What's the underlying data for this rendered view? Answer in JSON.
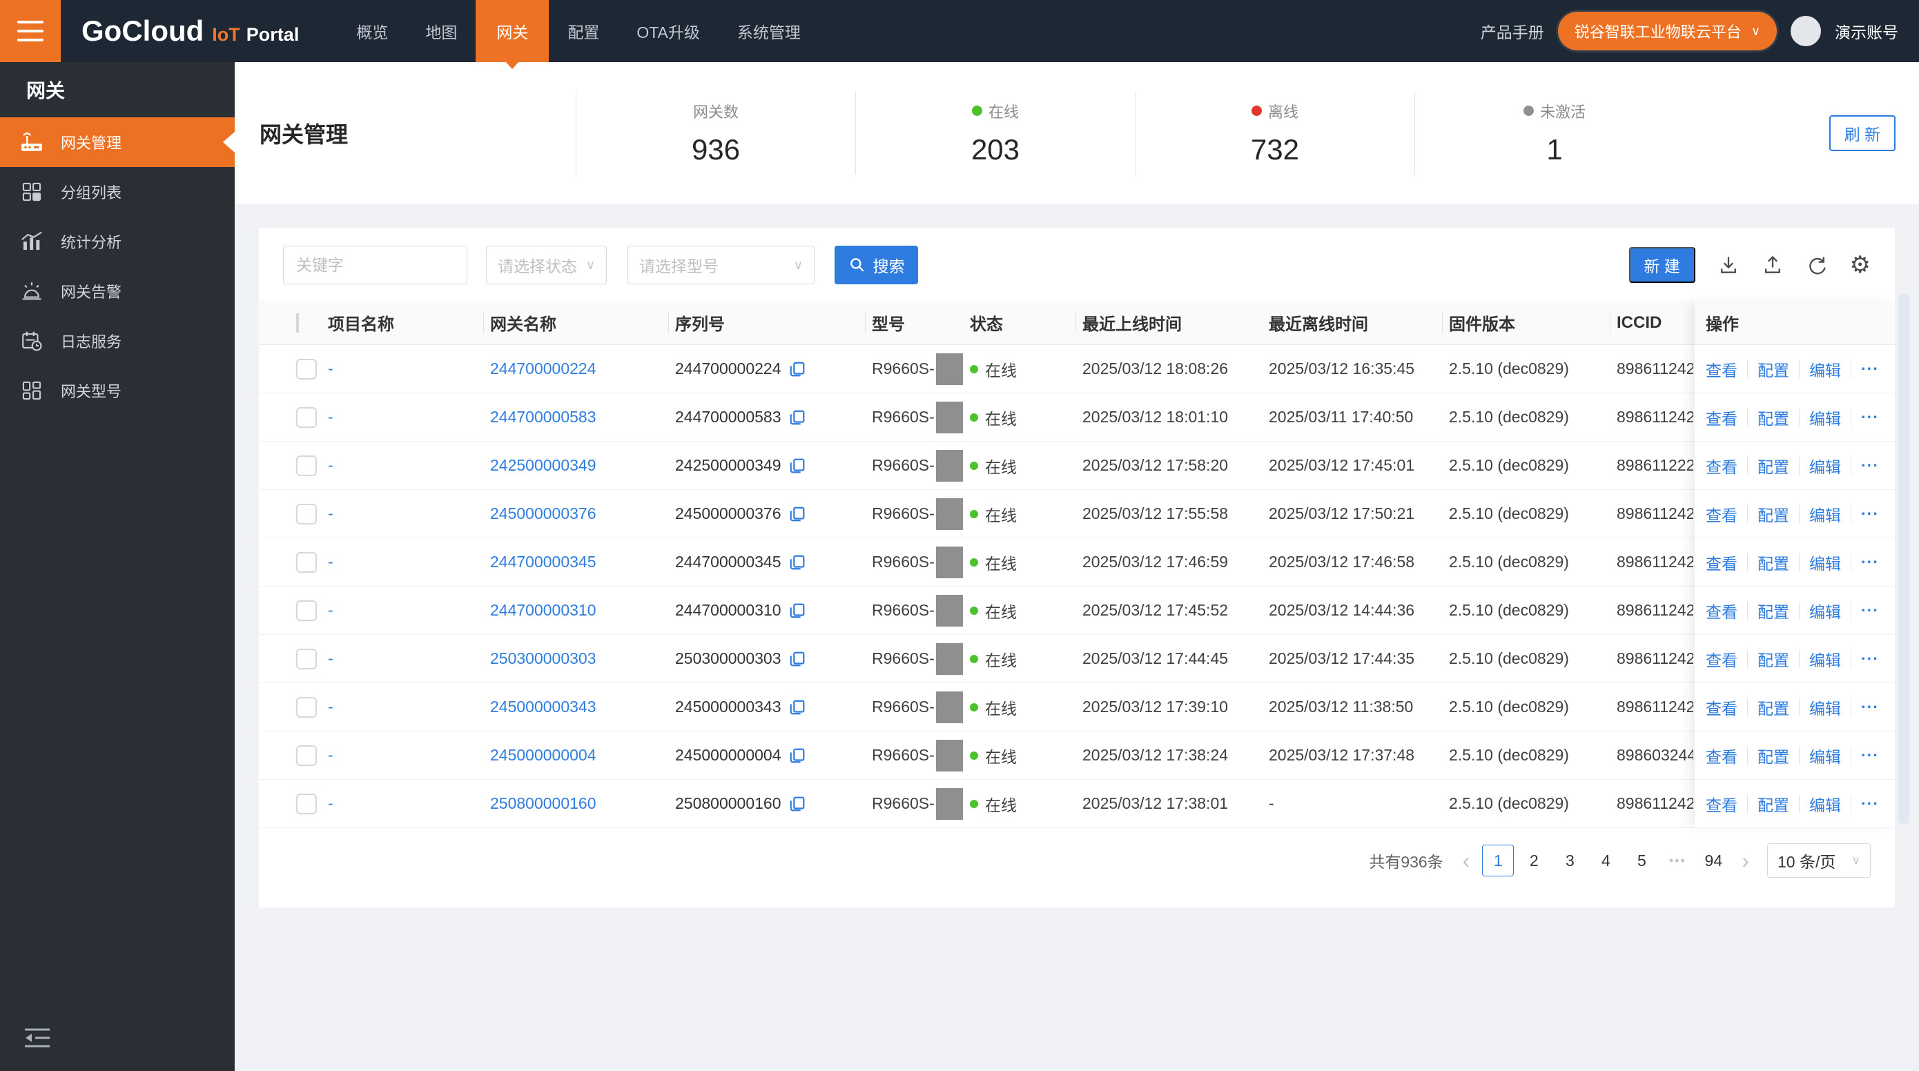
{
  "navbar": {
    "logo": {
      "brand": "GoCloud",
      "product": "IoT",
      "suffix": "Portal"
    },
    "items": [
      {
        "label": "概览"
      },
      {
        "label": "地图"
      },
      {
        "label": "网关",
        "active": true
      },
      {
        "label": "配置"
      },
      {
        "label": "OTA升级"
      },
      {
        "label": "系统管理"
      }
    ],
    "manual_link": "产品手册",
    "platform_selector": "锐谷智联工业物联云平台",
    "account": "演示账号"
  },
  "sidebar": {
    "title": "网关",
    "items": [
      {
        "label": "网关管理",
        "icon": "gateway-icon",
        "active": true
      },
      {
        "label": "分组列表",
        "icon": "group-list-icon"
      },
      {
        "label": "统计分析",
        "icon": "statistics-icon"
      },
      {
        "label": "网关告警",
        "icon": "alarm-icon"
      },
      {
        "label": "日志服务",
        "icon": "log-service-icon"
      },
      {
        "label": "网关型号",
        "icon": "gateway-model-icon"
      }
    ]
  },
  "header": {
    "title": "网关管理",
    "stats": [
      {
        "label": "网关数",
        "value": "936",
        "dot_color": ""
      },
      {
        "label": "在线",
        "value": "203",
        "dot_color": "#4cc22a"
      },
      {
        "label": "离线",
        "value": "732",
        "dot_color": "#e2352c"
      },
      {
        "label": "未激活",
        "value": "1",
        "dot_color": "#8f8f8f"
      }
    ],
    "refresh_label": "刷 新"
  },
  "toolbar": {
    "keyword_placeholder": "关键字",
    "status_placeholder": "请选择状态",
    "model_placeholder": "请选择型号",
    "search_label": "搜索",
    "create_label": "新 建"
  },
  "table": {
    "columns": [
      "项目名称",
      "网关名称",
      "序列号",
      "型号",
      "状态",
      "最近上线时间",
      "最近离线时间",
      "固件版本",
      "ICCID",
      "操作"
    ],
    "actions": [
      "查看",
      "配置",
      "编辑",
      "···"
    ],
    "rows": [
      {
        "project": "-",
        "name": "244700000224",
        "serial": "244700000224",
        "model": "R9660S-",
        "status": "在线",
        "online_time": "2025/03/12 18:08:26",
        "offline_time": "2025/03/12 16:35:45",
        "firmware": "2.5.10 (dec0829)",
        "iccid": "898611242"
      },
      {
        "project": "-",
        "name": "244700000583",
        "serial": "244700000583",
        "model": "R9660S-",
        "status": "在线",
        "online_time": "2025/03/12 18:01:10",
        "offline_time": "2025/03/11 17:40:50",
        "firmware": "2.5.10 (dec0829)",
        "iccid": "898611242"
      },
      {
        "project": "-",
        "name": "242500000349",
        "serial": "242500000349",
        "model": "R9660S-",
        "status": "在线",
        "online_time": "2025/03/12 17:58:20",
        "offline_time": "2025/03/12 17:45:01",
        "firmware": "2.5.10 (dec0829)",
        "iccid": "898611222"
      },
      {
        "project": "-",
        "name": "245000000376",
        "serial": "245000000376",
        "model": "R9660S-",
        "status": "在线",
        "online_time": "2025/03/12 17:55:58",
        "offline_time": "2025/03/12 17:50:21",
        "firmware": "2.5.10 (dec0829)",
        "iccid": "898611242"
      },
      {
        "project": "-",
        "name": "244700000345",
        "serial": "244700000345",
        "model": "R9660S-",
        "status": "在线",
        "online_time": "2025/03/12 17:46:59",
        "offline_time": "2025/03/12 17:46:58",
        "firmware": "2.5.10 (dec0829)",
        "iccid": "898611242"
      },
      {
        "project": "-",
        "name": "244700000310",
        "serial": "244700000310",
        "model": "R9660S-",
        "status": "在线",
        "online_time": "2025/03/12 17:45:52",
        "offline_time": "2025/03/12 14:44:36",
        "firmware": "2.5.10 (dec0829)",
        "iccid": "898611242"
      },
      {
        "project": "-",
        "name": "250300000303",
        "serial": "250300000303",
        "model": "R9660S-",
        "status": "在线",
        "online_time": "2025/03/12 17:44:45",
        "offline_time": "2025/03/12 17:44:35",
        "firmware": "2.5.10 (dec0829)",
        "iccid": "898611242"
      },
      {
        "project": "-",
        "name": "245000000343",
        "serial": "245000000343",
        "model": "R9660S-",
        "status": "在线",
        "online_time": "2025/03/12 17:39:10",
        "offline_time": "2025/03/12 11:38:50",
        "firmware": "2.5.10 (dec0829)",
        "iccid": "898611242"
      },
      {
        "project": "-",
        "name": "245000000004",
        "serial": "245000000004",
        "model": "R9660S-",
        "status": "在线",
        "online_time": "2025/03/12 17:38:24",
        "offline_time": "2025/03/12 17:37:48",
        "firmware": "2.5.10 (dec0829)",
        "iccid": "898603244"
      },
      {
        "project": "-",
        "name": "250800000160",
        "serial": "250800000160",
        "model": "R9660S-",
        "status": "在线",
        "online_time": "2025/03/12 17:38:01",
        "offline_time": "-",
        "firmware": "2.5.10 (dec0829)",
        "iccid": "898611242"
      }
    ]
  },
  "pagination": {
    "total_label": "共有936条",
    "pages": [
      "1",
      "2",
      "3",
      "4",
      "5",
      "•••",
      "94"
    ],
    "current_page": "1",
    "page_size": "10 条/页"
  },
  "colors": {
    "accent_orange": "#ed7223",
    "primary_blue": "#2e7ce0",
    "online_green": "#4cc22a",
    "offline_red": "#e2352c",
    "inactive_gray": "#8f8f8f"
  }
}
